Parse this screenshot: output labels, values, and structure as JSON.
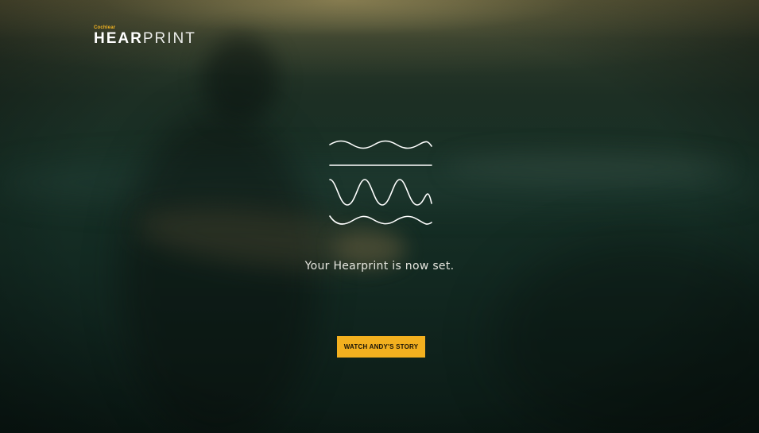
{
  "logo": {
    "brand": "Cochlear",
    "word_bold": "HEAR",
    "word_light": "PRINT"
  },
  "icon": {
    "name": "hearprint-waves-icon",
    "stroke_color": "#ffffff"
  },
  "message": "Your Hearprint is now set.",
  "cta": {
    "label": "WATCH ANDY'S STORY",
    "color": "#f3b01f"
  }
}
